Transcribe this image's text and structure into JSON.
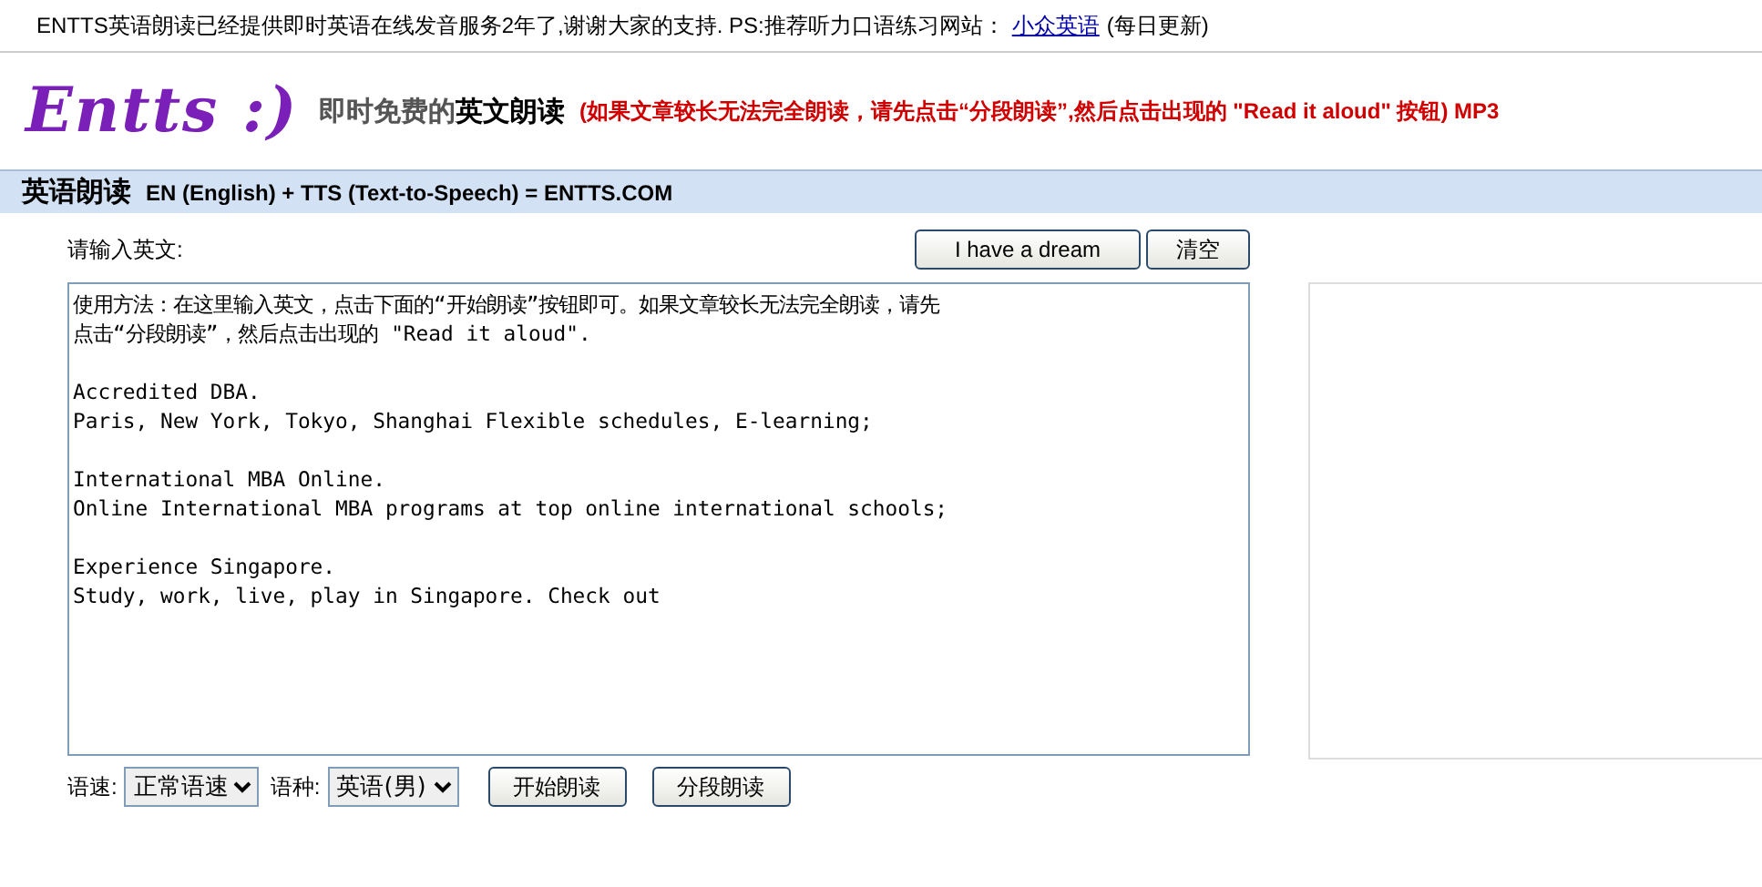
{
  "notice": {
    "text": "ENTTS英语朗读已经提供即时英语在线发音服务2年了,谢谢大家的支持.  PS:推荐听力口语练习网站：",
    "link": "小众英语",
    "suffix": "(每日更新)"
  },
  "header": {
    "logo": "Entts :)",
    "tagline_prefix": "即时免费的",
    "tagline_bold": "英文朗读",
    "hint": "(如果文章较长无法完全朗读，请先点击“分段朗读”,然后点击出现的  \"Read it aloud\" 按钮) MP3"
  },
  "section_bar": {
    "title": "英语朗读",
    "subtitle": "EN (English) + TTS (Text-to-Speech) = ENTTS.COM"
  },
  "input_label": "请输入英文:",
  "top_buttons": [
    "I have a dream",
    "清空"
  ],
  "text_paragraphs": [
    [
      "使用方法：在这里输入英文，点击下面的“开始朗读”按钮即可。如果文章较长无法完全朗读，请先",
      "点击“分段朗读”，然后点击出现的 \"Read it aloud\"."
    ],
    [
      "Accredited DBA.",
      "Paris, New York, Tokyo, Shanghai Flexible schedules, E-learning;"
    ],
    [
      "International MBA Online.",
      "Online International MBA programs at top online international schools;"
    ],
    [
      "Experience Singapore.",
      "Study, work, live, play in Singapore. Check out"
    ]
  ],
  "controls": [
    {
      "label": "语速:",
      "value": "正常语速"
    },
    {
      "label": "语种:",
      "value": "英语(男)"
    }
  ],
  "bottom_buttons": [
    "开始朗读",
    "分段朗读"
  ]
}
